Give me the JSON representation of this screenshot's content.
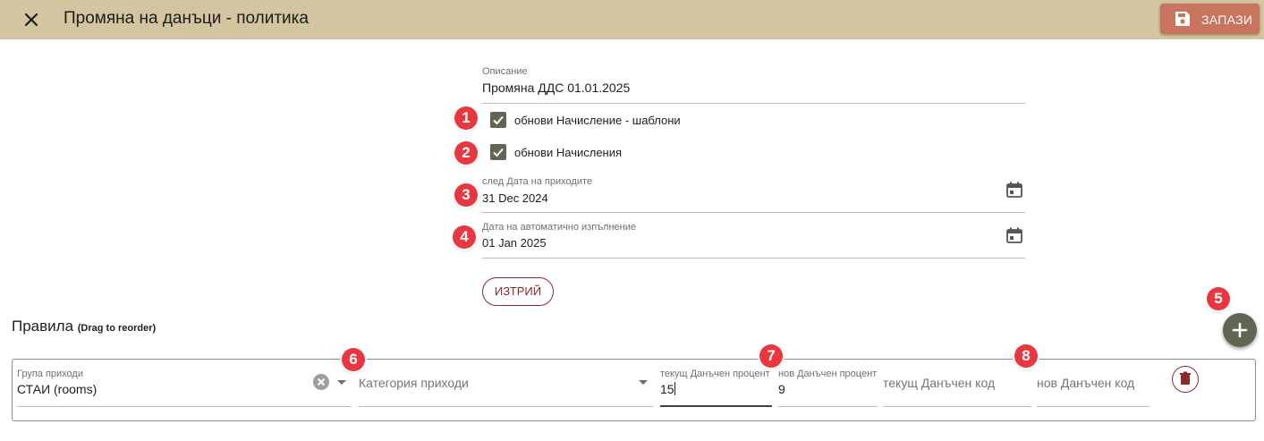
{
  "header": {
    "title": "Промяна на данъци - политика",
    "save_label": "ЗАПАЗИ",
    "close_icon": "close-icon",
    "save_icon": "floppy-disk-icon",
    "bar_color": "#d3c59f",
    "save_color": "#c9745e"
  },
  "form": {
    "description_label": "Описание",
    "description_value": "Промяна ДДС 01.01.2025",
    "checkbox1_label": "обнови Начисление - шаблони",
    "checkbox1_checked": true,
    "checkbox2_label": "обнови Начисления",
    "checkbox2_checked": true,
    "after_date_label": "след Дата на приходите",
    "after_date_value": "31 Dec 2024",
    "auto_date_label": "Дата на автоматично изпълнение",
    "auto_date_value": "01 Jan 2025",
    "delete_label": "ИЗТРИЙ"
  },
  "rules": {
    "title": "Правила",
    "hint": "(Drag to reorder)",
    "add_icon": "plus-icon",
    "row": {
      "revenue_group_label": "Група приходи",
      "revenue_group_value": "СТАИ (rooms)",
      "revenue_category_placeholder": "Категория приходи",
      "current_tax_percent_label": "текущ Данъчен процент",
      "current_tax_percent_value": "15",
      "new_tax_percent_label": "нов Данъчен процент",
      "new_tax_percent_value": "9",
      "current_tax_code_placeholder": "текущ Данъчен код",
      "new_tax_code_placeholder": "нов Данъчен код",
      "delete_icon": "trash-icon"
    }
  },
  "annotations": [
    "1",
    "2",
    "3",
    "4",
    "5",
    "6",
    "7",
    "8"
  ],
  "colors": {
    "accent": "#5f6652",
    "danger": "#8d2a2a",
    "badge": "#e8373e"
  }
}
